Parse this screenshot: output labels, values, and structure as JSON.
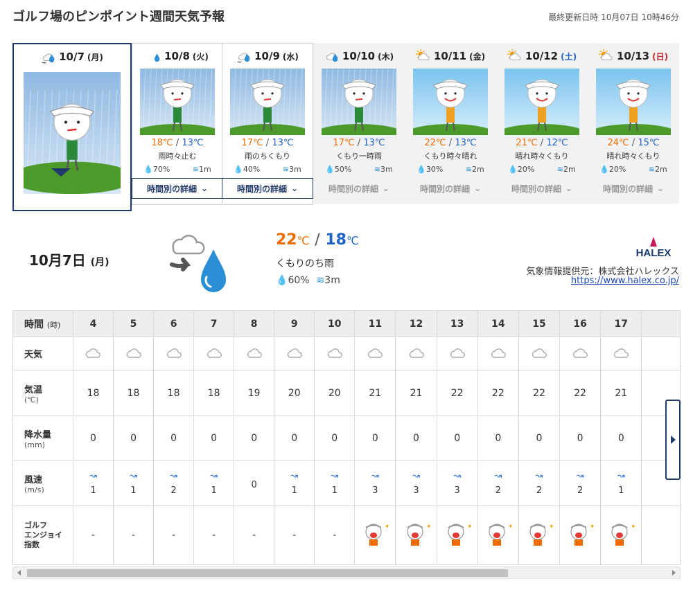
{
  "page": {
    "title": "ゴルフ場のピンポイント週間天気予報",
    "updated": "最終更新日時 10月07日 10時46分"
  },
  "days": [
    {
      "date": "10/7",
      "dow": "(月)",
      "icon": "cloudy-then-rain-icon",
      "selected": true
    },
    {
      "date": "10/8",
      "dow": "(火)",
      "icon": "rain-icon",
      "hi": "18",
      "lo": "13",
      "desc": "雨時々止む",
      "rain": "70%",
      "wind": "1m",
      "button": "時間別の詳細"
    },
    {
      "date": "10/9",
      "dow": "(水)",
      "icon": "rain-then-cloudy-icon",
      "hi": "17",
      "lo": "13",
      "desc": "雨のちくもり",
      "rain": "40%",
      "wind": "3m",
      "button": "時間別の詳細"
    },
    {
      "date": "10/10",
      "dow": "(木)",
      "icon": "cloudy-rain-icon",
      "hi": "17",
      "lo": "13",
      "desc": "くもり一時雨",
      "rain": "50%",
      "wind": "3m",
      "button": "時間別の詳細"
    },
    {
      "date": "10/11",
      "dow": "(金)",
      "icon": "sun-cloud-icon",
      "hi": "22",
      "lo": "13",
      "desc": "くもり時々晴れ",
      "rain": "30%",
      "wind": "2m",
      "button": "時間別の詳細"
    },
    {
      "date": "10/12",
      "dow": "(土)",
      "icon": "sun-cloud-icon",
      "hi": "21",
      "lo": "12",
      "desc": "晴れ時々くもり",
      "rain": "20%",
      "wind": "2m",
      "button": "時間別の詳細"
    },
    {
      "date": "10/13",
      "dow": "(日)",
      "icon": "sun-cloud-icon",
      "hi": "24",
      "lo": "15",
      "desc": "晴れ時々くもり",
      "rain": "20%",
      "wind": "2m",
      "button": "時間別の詳細"
    }
  ],
  "units": {
    "c": "℃",
    "slash": "/"
  },
  "summary": {
    "date": "10月7日",
    "dow": "(月)",
    "hi": "22",
    "lo": "18",
    "desc": "くもりのち雨",
    "rain": "60%",
    "wind": "3m"
  },
  "provider": {
    "logo_text": "HALEX",
    "text": "気象情報提供元：株式会社ハレックス",
    "link": "https://www.halex.co.jp/"
  },
  "hourly": {
    "labels": {
      "hour": "時間",
      "hour_unit": "(時)",
      "weather": "天気",
      "temp": "気温",
      "temp_unit": "(℃)",
      "rain": "降水量",
      "rain_unit": "(mm)",
      "wind": "風速",
      "wind_unit": "(m/s)",
      "golf_line1": "ゴルフ",
      "golf_line2": "エンジョイ",
      "golf_line3": "指数"
    },
    "hours": [
      "4",
      "5",
      "6",
      "7",
      "8",
      "9",
      "10",
      "11",
      "12",
      "13",
      "14",
      "15",
      "16",
      "17"
    ],
    "weather_icon": "cloud-icon",
    "temps": [
      "18",
      "18",
      "18",
      "18",
      "19",
      "20",
      "20",
      "21",
      "21",
      "22",
      "22",
      "22",
      "22",
      "21"
    ],
    "rain": [
      "0",
      "0",
      "0",
      "0",
      "0",
      "0",
      "0",
      "0",
      "0",
      "0",
      "0",
      "0",
      "0",
      "0"
    ],
    "wind": [
      "1",
      "1",
      "2",
      "1",
      "0",
      "1",
      "1",
      "3",
      "3",
      "3",
      "2",
      "2",
      "2",
      "1"
    ],
    "golf": [
      "-",
      "-",
      "-",
      "-",
      "-",
      "-",
      "-",
      "happy-golfer-icon",
      "happy-golfer-icon",
      "happy-golfer-icon",
      "happy-golfer-icon",
      "happy-golfer-icon",
      "happy-golfer-icon",
      "happy-golfer-icon"
    ]
  },
  "colors": {
    "navy": "#223a6b",
    "hi": "#ef6c00",
    "lo": "#1e62c6",
    "sat": "#1e62c6",
    "sun": "#c62828"
  }
}
